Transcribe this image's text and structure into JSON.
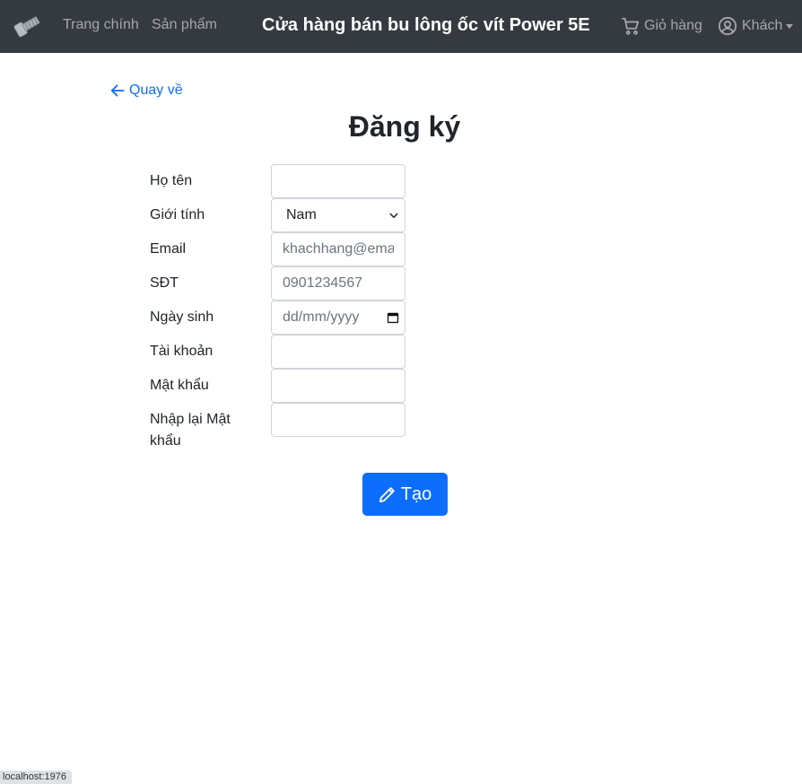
{
  "navbar": {
    "logo_icon": "bolt-logo-icon",
    "links": [
      "Trang chính",
      "Sản phẩm"
    ],
    "title": "Cửa hàng bán bu lông ốc vít Power 5E",
    "cart": {
      "icon": "cart-icon",
      "label": "Giỏ hàng"
    },
    "user": {
      "icon": "user-circle-icon",
      "label": "Khách"
    }
  },
  "back": {
    "icon": "arrow-left-icon",
    "label": "Quay về"
  },
  "page_title": "Đăng ký",
  "form": {
    "fullname": {
      "label": "Họ tên",
      "value": "",
      "placeholder": ""
    },
    "gender": {
      "label": "Giới tính",
      "selected": "Nam"
    },
    "email": {
      "label": "Email",
      "placeholder": "khachhang@email"
    },
    "phone": {
      "label": "SĐT",
      "placeholder": "0901234567"
    },
    "birthday": {
      "label": "Ngày sinh",
      "placeholder": "dd/mm/yyyy"
    },
    "username": {
      "label": "Tài khoản",
      "value": ""
    },
    "password": {
      "label": "Mật khẩu",
      "value": ""
    },
    "confirm_password": {
      "label": "Nhập lại Mật khẩu",
      "value": ""
    },
    "submit": {
      "icon": "pencil-icon",
      "label": "Tạo"
    }
  },
  "status_bar": "localhost:1976",
  "colors": {
    "navbar_bg": "#343a40",
    "primary": "#0d6efd"
  }
}
